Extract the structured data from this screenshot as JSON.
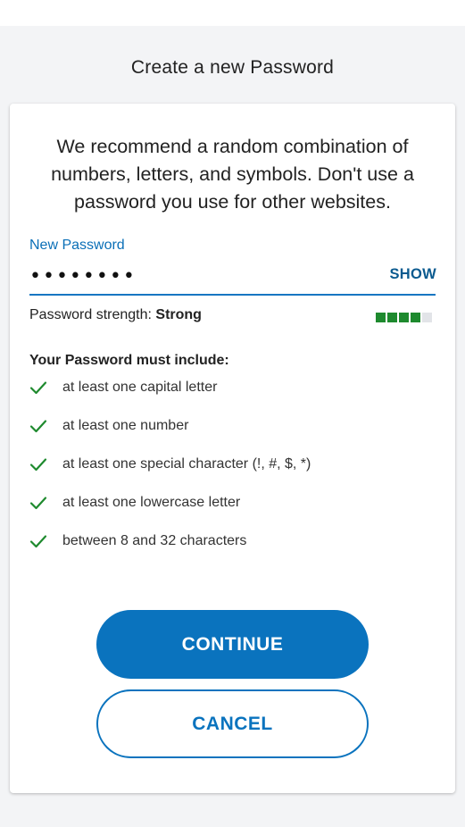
{
  "page": {
    "title": "Create a new Password"
  },
  "card": {
    "intro": "We recommend a random combination of numbers, letters, and symbols. Don't use a password you use for other websites.",
    "password_field": {
      "label": "New Password",
      "value": "••••••••",
      "show_label": "SHOW"
    },
    "strength": {
      "prefix": "Password strength: ",
      "value": "Strong",
      "level_filled": 4,
      "level_total": 5,
      "filled_color": "#1e8a2e",
      "empty_color": "#e2e4e8"
    },
    "requirements": {
      "heading": "Your Password must include:",
      "check_color": "#1e8a2e",
      "items": [
        {
          "label": "at least one capital letter",
          "icon": "check-icon",
          "met": true
        },
        {
          "label": "at least one number",
          "icon": "check-icon",
          "met": true
        },
        {
          "label": "at least one special character (!, #, $, *)",
          "icon": "check-icon",
          "met": true
        },
        {
          "label": "at least one lowercase letter",
          "icon": "check-icon",
          "met": true
        },
        {
          "label": "between 8 and 32 characters",
          "icon": "check-icon",
          "met": true
        }
      ]
    },
    "actions": {
      "continue_label": "CONTINUE",
      "cancel_label": "CANCEL",
      "accent_color": "#0a73be"
    }
  }
}
